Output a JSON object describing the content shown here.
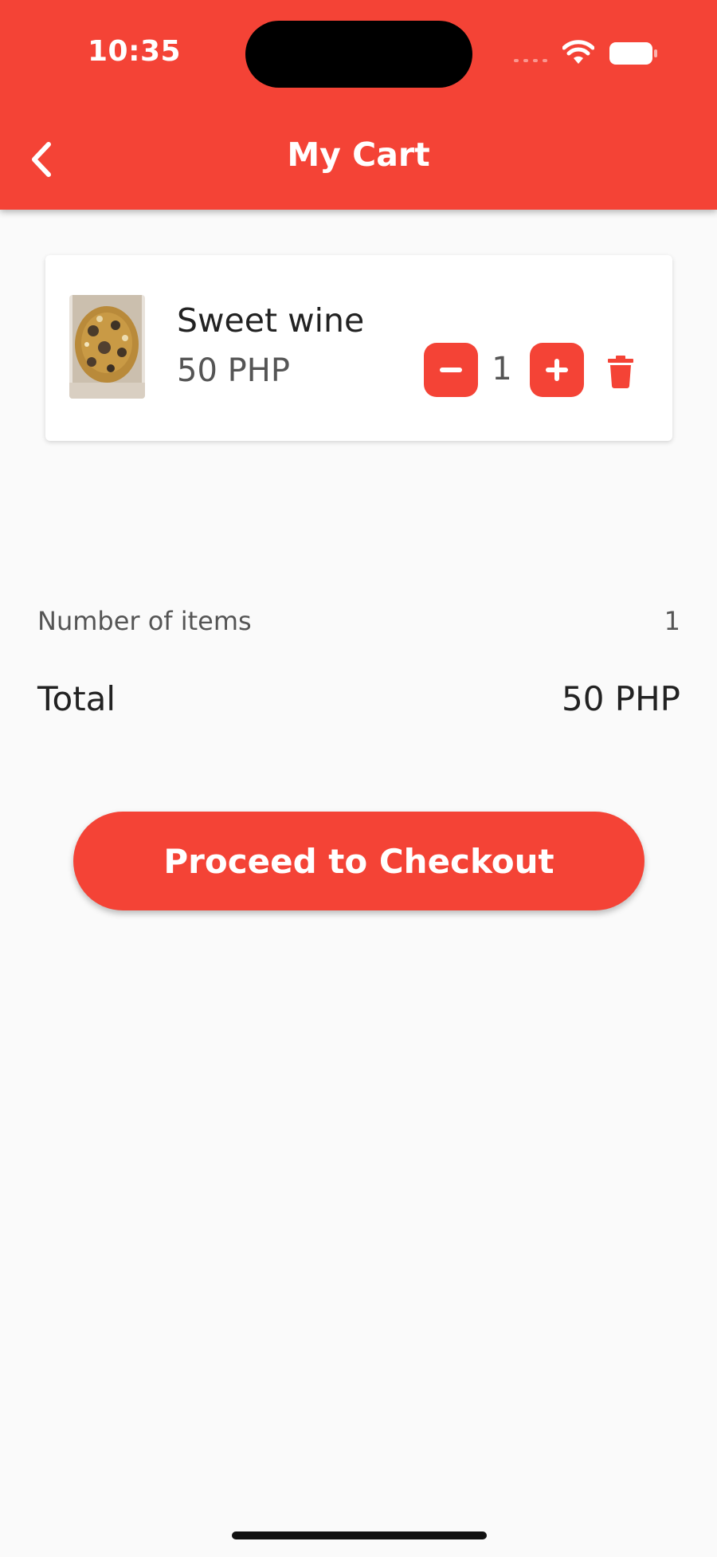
{
  "status_bar": {
    "time": "10:35"
  },
  "header": {
    "title": "My Cart",
    "back_icon": "chevron-left-icon"
  },
  "cart": {
    "items": [
      {
        "name": "Sweet wine",
        "price": "50 PHP",
        "quantity": "1"
      }
    ]
  },
  "summary": {
    "items_label": "Number of items",
    "items_count": "1",
    "total_label": "Total",
    "total_value": "50 PHP"
  },
  "checkout": {
    "label": "Proceed to Checkout"
  },
  "colors": {
    "primary": "#f44336",
    "background": "#fafafa"
  }
}
